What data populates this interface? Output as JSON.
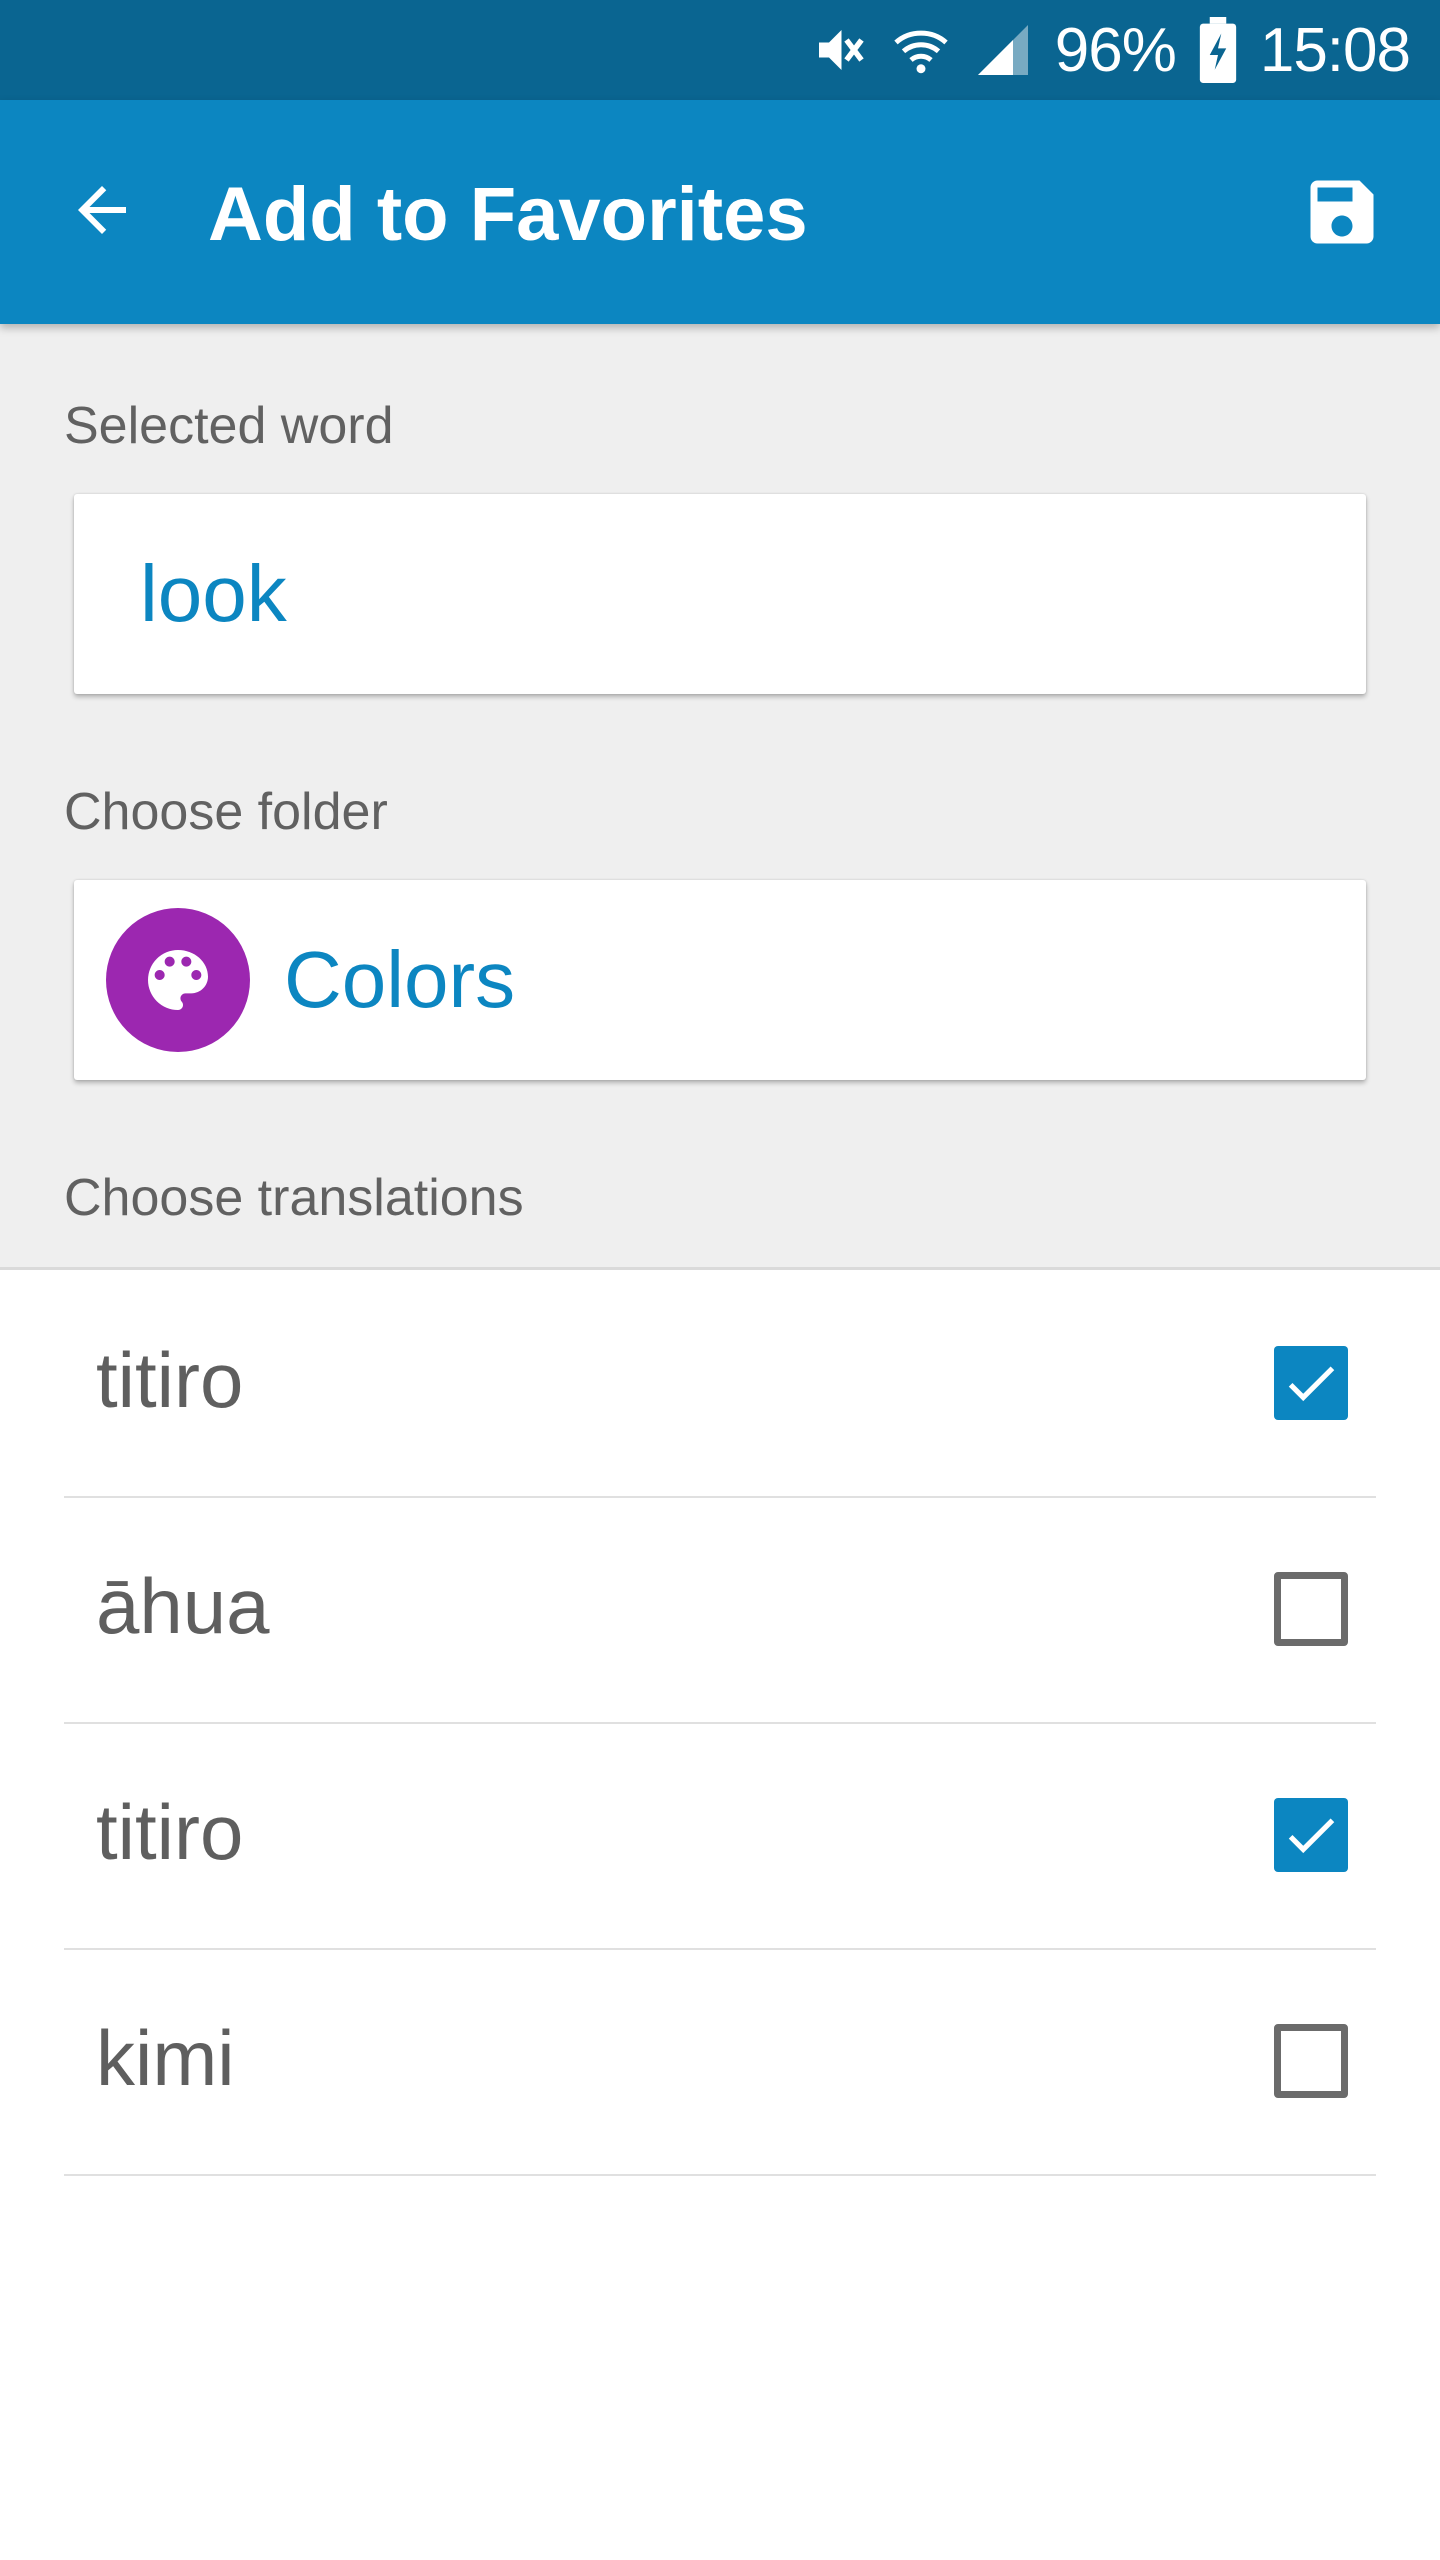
{
  "status_bar": {
    "icons": [
      "mute-icon",
      "wifi-icon",
      "signal-icon",
      "battery-charging-icon"
    ],
    "battery": "96%",
    "time": "15:08"
  },
  "app_bar": {
    "back_icon": "arrow-back-icon",
    "title": "Add to Favorites",
    "save_icon": "save-icon",
    "color": "#0c86c1"
  },
  "form": {
    "selected_word_label": "Selected word",
    "selected_word": "look",
    "choose_folder_label": "Choose folder",
    "folder": {
      "name": "Colors",
      "icon": "palette-icon",
      "icon_color": "#9c27b0"
    },
    "choose_translations_label": "Choose translations"
  },
  "translations": [
    {
      "text": "titiro",
      "checked": true
    },
    {
      "text": "āhua",
      "checked": false
    },
    {
      "text": "titiro",
      "checked": true
    },
    {
      "text": "kimi",
      "checked": false
    }
  ]
}
